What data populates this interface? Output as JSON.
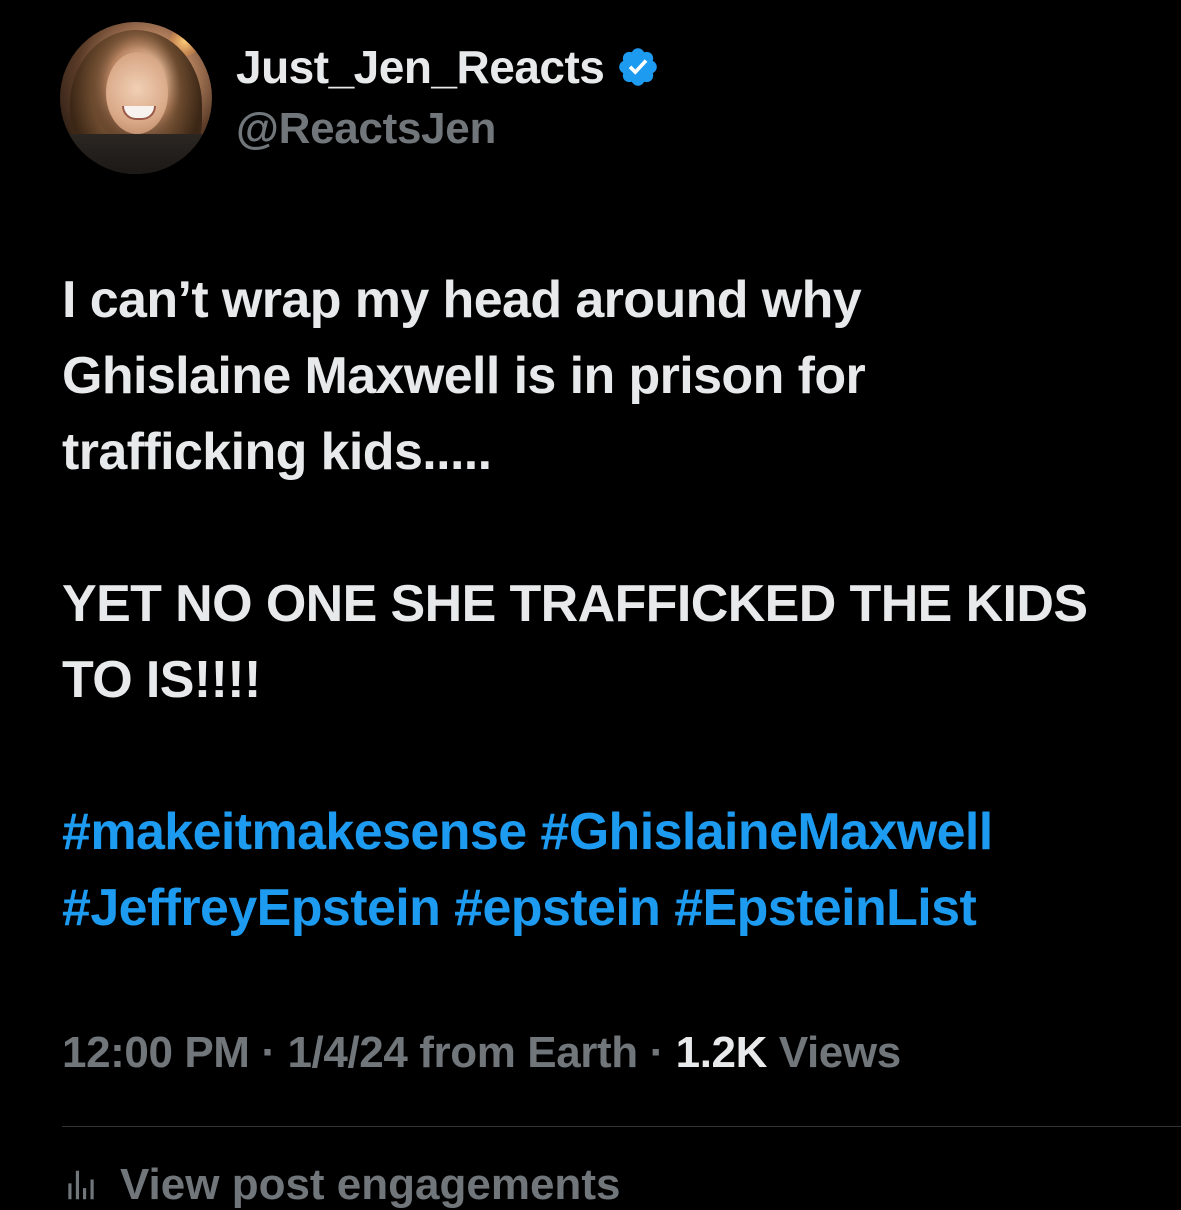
{
  "author": {
    "display_name": "Just_Jen_Reacts",
    "handle": "@ReactsJen",
    "verified": true,
    "verified_icon": "verified-badge-icon",
    "avatar_icon": "profile-photo"
  },
  "tweet": {
    "lines": [
      "I can’t wrap my head around why",
      "Ghislaine Maxwell is in prison for",
      "trafficking kids.....",
      "YET NO ONE SHE TRAFFICKED THE KIDS",
      "TO IS!!!!"
    ],
    "hashtags": [
      "#makeitmakesense",
      "#GhislaineMaxwell",
      "#JeffreyEpstein",
      "#epstein",
      "#EpsteinList"
    ]
  },
  "meta": {
    "time": "12:00 PM",
    "separator": "·",
    "date": "1/4/24",
    "source": "from Earth",
    "views_count": "1.2K",
    "views_label": "Views"
  },
  "footer": {
    "engagements_label": "View post engagements",
    "engagements_icon": "bar-chart-icon"
  },
  "colors": {
    "background": "#000000",
    "text": "#e7e9ea",
    "secondary": "#71767b",
    "accent": "#1d9bf0"
  }
}
